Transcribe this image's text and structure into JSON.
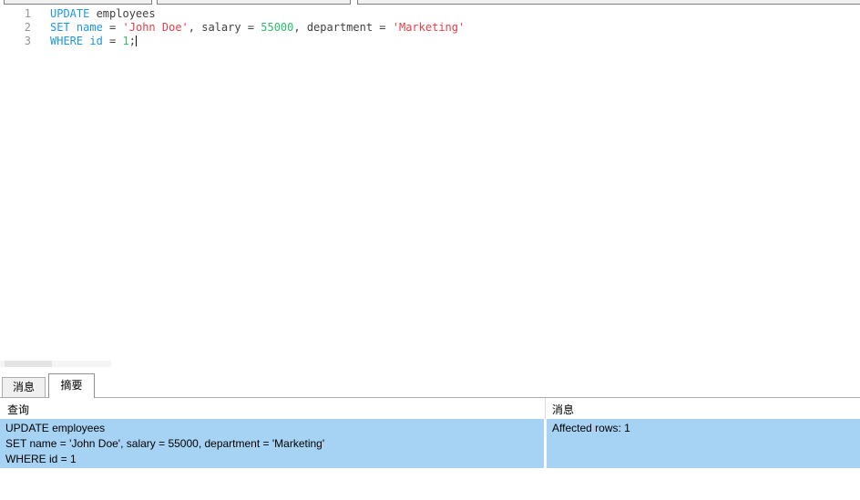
{
  "colors": {
    "keyword": "#1e96e8",
    "string": "#e5404a",
    "number": "#2ebe6e",
    "identifier": "#404040",
    "line_number": "#949494",
    "selected_row_bg": "#a6d2f4",
    "tab_border": "#acacac"
  },
  "editor": {
    "line_numbers": [
      "1",
      "2",
      "3"
    ],
    "l1": {
      "kw1": "UPDATE",
      "id1": " employees"
    },
    "l2": {
      "kw1": "SET",
      "sp1": " ",
      "kw2": "name",
      "op1": " = ",
      "str1": "'John Doe'",
      "op2": ", salary = ",
      "num1": "55000",
      "op3": ", department = ",
      "str2": "'Marketing'"
    },
    "l3": {
      "kw1": "WHERE",
      "sp1": " ",
      "kw2": "id",
      "op1": " = ",
      "num1": "1",
      "op2": ";"
    }
  },
  "bottom_panel": {
    "tabs": [
      {
        "label": "消息",
        "active": false
      },
      {
        "label": "摘要",
        "active": true
      }
    ],
    "table": {
      "headers": {
        "query": "查询",
        "message": "消息"
      },
      "row": {
        "query_lines": [
          "UPDATE employees",
          "SET name = 'John Doe', salary = 55000, department = 'Marketing'",
          "WHERE id = 1"
        ],
        "message": "Affected rows: 1"
      }
    }
  }
}
